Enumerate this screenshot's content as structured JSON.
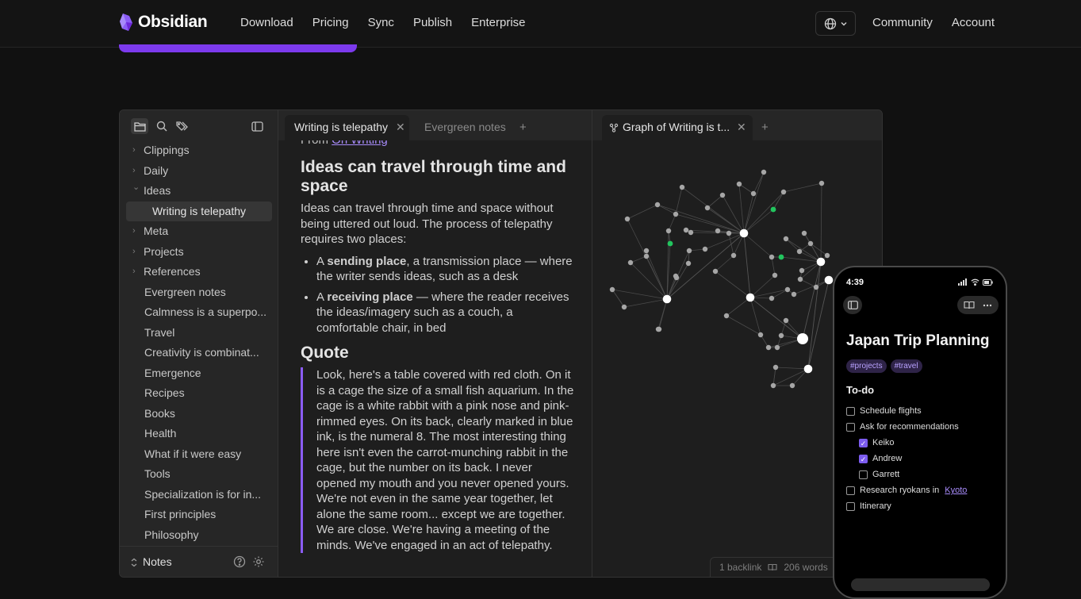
{
  "nav": {
    "brand": "Obsidian",
    "links": [
      "Download",
      "Pricing",
      "Sync",
      "Publish",
      "Enterprise"
    ],
    "right_links": [
      "Community",
      "Account"
    ],
    "lang_icon": "globe-icon"
  },
  "sidebar": {
    "tree": [
      {
        "label": "Clippings",
        "type": "folder"
      },
      {
        "label": "Daily",
        "type": "folder"
      },
      {
        "label": "Ideas",
        "type": "folder-open"
      },
      {
        "label": "Writing is telepathy",
        "type": "child-active"
      },
      {
        "label": "Meta",
        "type": "folder"
      },
      {
        "label": "Projects",
        "type": "folder"
      },
      {
        "label": "References",
        "type": "folder"
      },
      {
        "label": "Evergreen notes",
        "type": "file"
      },
      {
        "label": "Calmness is a superpo...",
        "type": "file"
      },
      {
        "label": "Travel",
        "type": "file"
      },
      {
        "label": "Creativity is combinat...",
        "type": "file"
      },
      {
        "label": "Emergence",
        "type": "file"
      },
      {
        "label": "Recipes",
        "type": "file"
      },
      {
        "label": "Books",
        "type": "file"
      },
      {
        "label": "Health",
        "type": "file"
      },
      {
        "label": "What if it were easy",
        "type": "file"
      },
      {
        "label": "Tools",
        "type": "file"
      },
      {
        "label": "Specialization is for in...",
        "type": "file"
      },
      {
        "label": "First principles",
        "type": "file"
      },
      {
        "label": "Philosophy",
        "type": "file"
      }
    ],
    "vault_name": "Notes"
  },
  "tabs": {
    "left": [
      {
        "label": "Writing is telepathy",
        "active": true
      },
      {
        "label": "Evergreen notes",
        "active": false
      }
    ],
    "right": [
      {
        "label": "Graph of Writing is t...",
        "active": true
      }
    ]
  },
  "editor": {
    "from_prefix": "From ",
    "from_link": "On Writing",
    "heading1": "Ideas can travel through time and space",
    "para1": "Ideas can travel through time and space without being uttered out loud. The process of telepathy requires two places:",
    "bullet1_pre": "A ",
    "bullet1_bold": "sending place",
    "bullet1_post": ", a transmission place — where the writer sends ideas, such as a desk",
    "bullet2_pre": "A ",
    "bullet2_bold": "receiving place",
    "bullet2_post": " — where the reader receives the ideas/imagery such as a couch, a comfortable chair, in bed",
    "heading2": "Quote",
    "quote": "Look, here's a table covered with red cloth. On it is a cage the size of a small fish aquarium. In the cage is a white rabbit with a pink nose and pink-rimmed eyes. On its back, clearly marked in blue ink, is the numeral 8. The most interesting thing here isn't even the carrot-munching rabbit in the cage, but the number on its back. I never opened my mouth and you never opened yours. We're not even in the same year together, let alone the same room... except we are together. We are close. We're having a meeting of the minds. We've engaged in an act of telepathy."
  },
  "status": {
    "backlinks": "1 backlink",
    "words": "206 words"
  },
  "phone": {
    "time": "4:39",
    "title": "Japan Trip Planning",
    "tags": [
      "#projects",
      "#travel"
    ],
    "section": "To-do",
    "todos": [
      {
        "text": "Schedule flights",
        "checked": false,
        "indent": 0
      },
      {
        "text": "Ask for recommendations",
        "checked": false,
        "indent": 0
      },
      {
        "text": "Keiko",
        "checked": true,
        "indent": 1
      },
      {
        "text": "Andrew",
        "checked": true,
        "indent": 1
      },
      {
        "text": "Garrett",
        "checked": false,
        "indent": 1
      },
      {
        "text": "Research ryokans in ",
        "link": "Kyoto",
        "checked": false,
        "indent": 0
      },
      {
        "text": "Itinerary",
        "checked": false,
        "indent": 0
      }
    ]
  },
  "colors": {
    "accent": "#7c3aed",
    "graph_node": "#a6a6a6",
    "graph_hub": "#ffffff",
    "graph_green": "#22c55e"
  }
}
